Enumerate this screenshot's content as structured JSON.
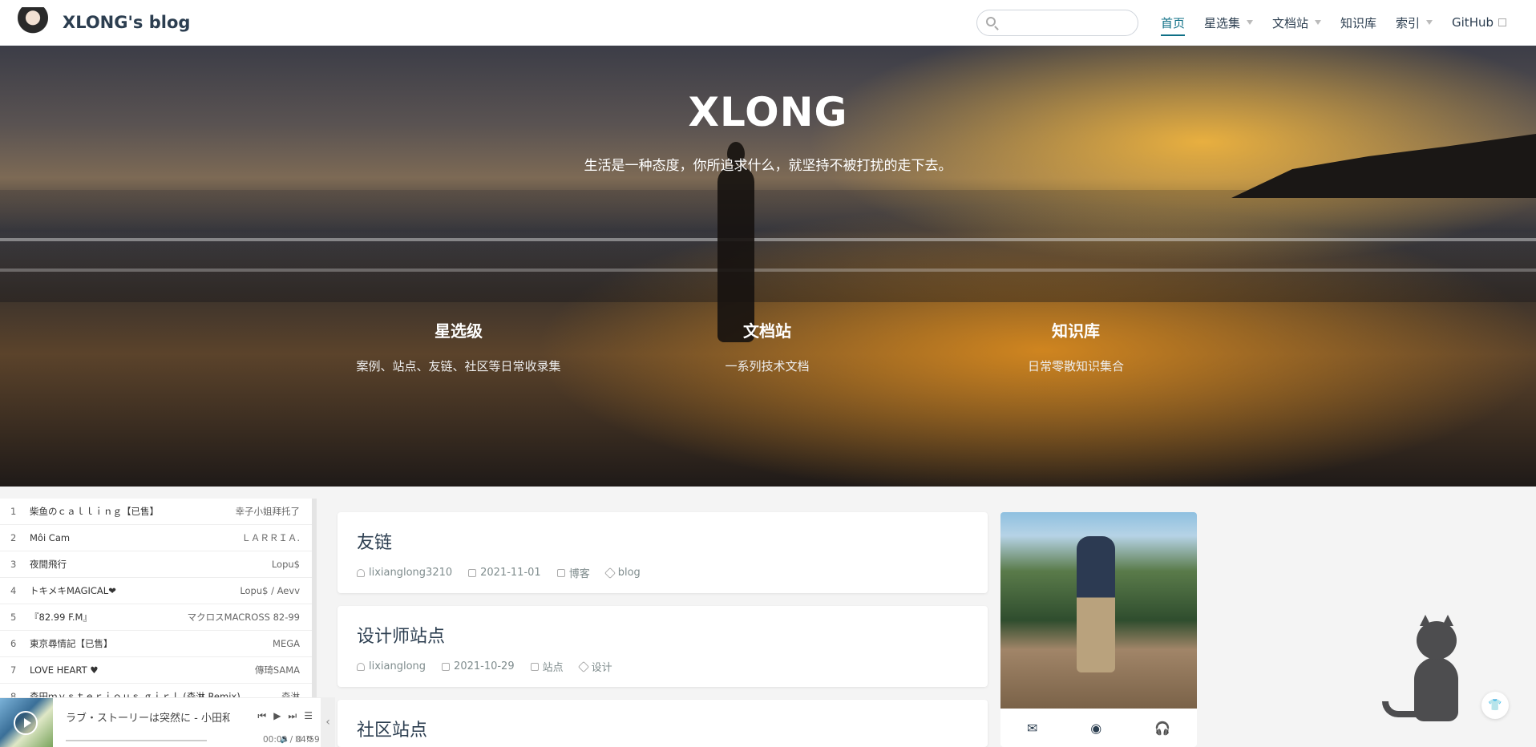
{
  "site": {
    "name": "XLONG's blog",
    "logo_icon": "avatar-logo-icon"
  },
  "nav": {
    "search_placeholder": "",
    "items": [
      {
        "label": "首页",
        "active": true,
        "dropdown": false
      },
      {
        "label": "星选集",
        "active": false,
        "dropdown": true
      },
      {
        "label": "文档站",
        "active": false,
        "dropdown": true
      },
      {
        "label": "知识库",
        "active": false,
        "dropdown": false
      },
      {
        "label": "索引",
        "active": false,
        "dropdown": true
      },
      {
        "label": "GitHub",
        "active": false,
        "external": true
      }
    ]
  },
  "hero": {
    "title": "XLONG",
    "description": "生活是一种态度，你所追求什么，就坚持不被打扰的走下去。",
    "features": [
      {
        "title": "星选级",
        "desc": "案例、站点、友链、社区等日常收录集"
      },
      {
        "title": "文档站",
        "desc": "一系列技术文档"
      },
      {
        "title": "知识库",
        "desc": "日常零散知识集合"
      }
    ]
  },
  "music": {
    "playlist": [
      {
        "idx": "1",
        "title": "柴鱼のｃａｌｌｉｎｇ【已售】",
        "artist": "幸子小姐拜托了"
      },
      {
        "idx": "2",
        "title": "Môi Cam",
        "artist": "ＬＡＲＲＩＡ."
      },
      {
        "idx": "3",
        "title": "夜間飛行",
        "artist": "Lopu$"
      },
      {
        "idx": "4",
        "title": "トキメキMAGICAL❤",
        "artist": "Lopu$ / Aevv"
      },
      {
        "idx": "5",
        "title": "『82.99 F.M』",
        "artist": "マクロスMACROSS 82-99"
      },
      {
        "idx": "6",
        "title": "東京尋情記【已售】",
        "artist": "MEGA"
      },
      {
        "idx": "7",
        "title": "LOVE HEART ♥",
        "artist": "傳琦SAMA"
      },
      {
        "idx": "8",
        "title": "森田ｍｙｓｔｅｒｉｏｕｓ ｇｉｒｌ (森淋 Remix)",
        "artist": "森淋"
      }
    ],
    "now_playing": "ラブ・ストーリーは突然に - 小田和正",
    "time": "00:00 / 04:59"
  },
  "posts": [
    {
      "title": "友链",
      "author": "lixianglong3210",
      "date": "2021-11-01",
      "category": "博客",
      "tag": "blog"
    },
    {
      "title": "设计师站点",
      "author": "lixianglong",
      "date": "2021-10-29",
      "category": "站点",
      "tag": "设计"
    },
    {
      "title": "社区站点"
    }
  ],
  "profile": {
    "icons": [
      "mail-icon",
      "github-icon",
      "headphones-icon"
    ]
  },
  "colors": {
    "accent": "#0e6f86",
    "text": "#2c3e50"
  }
}
